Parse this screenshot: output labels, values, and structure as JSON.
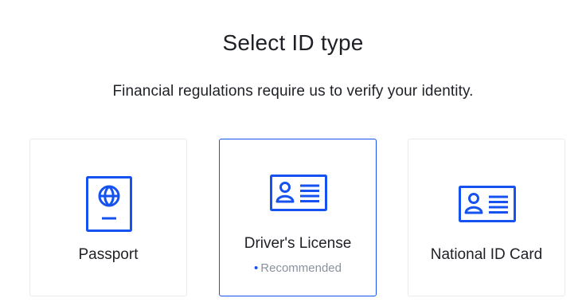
{
  "header": {
    "title": "Select ID type",
    "subtitle": "Financial regulations require us to verify your identity."
  },
  "options": [
    {
      "label": "Passport",
      "icon": "passport-icon"
    },
    {
      "label": "Driver's License",
      "icon": "id-card-icon",
      "badge": "Recommended",
      "selected": true
    },
    {
      "label": "National ID Card",
      "icon": "id-card-icon"
    }
  ],
  "colors": {
    "accent": "#1652f0",
    "border": "#e9ebef",
    "muted_text": "#8a919e",
    "text": "#1e2026"
  }
}
